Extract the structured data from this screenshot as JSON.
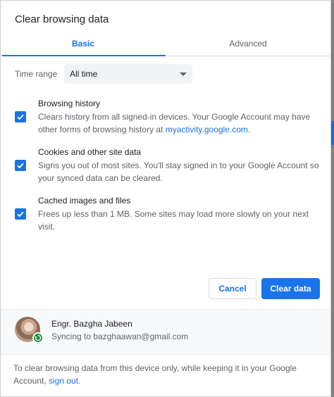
{
  "dialog": {
    "title": "Clear browsing data"
  },
  "tabs": [
    {
      "label": "Basic",
      "active": true
    },
    {
      "label": "Advanced",
      "active": false
    }
  ],
  "time_range": {
    "label": "Time range",
    "value": "All time"
  },
  "options": [
    {
      "title": "Browsing history",
      "desc_pre": "Clears history from all signed-in devices. Your Google Account may have other forms of browsing history at ",
      "desc_link": "myactivity.google.com",
      "desc_post": ".",
      "checked": true
    },
    {
      "title": "Cookies and other site data",
      "desc": "Signs you out of most sites. You'll stay signed in to your Google Account so your synced data can be cleared.",
      "checked": true
    },
    {
      "title": "Cached images and files",
      "desc": "Frees up less than 1 MB. Some sites may load more slowly on your next visit.",
      "checked": true
    }
  ],
  "buttons": {
    "cancel": "Cancel",
    "clear": "Clear data"
  },
  "account": {
    "name": "Engr. Bazgha Jabeen",
    "sync_status": "Syncing to bazghaawan@gmail.com"
  },
  "footer": {
    "text_pre": "To clear browsing data from this device only, while keeping it in your Google Account, ",
    "link": "sign out",
    "text_post": "."
  },
  "colors": {
    "accent": "#1a73e8",
    "sync_badge": "#1e8e3e"
  },
  "icons": [
    "checkbox-checked-icon",
    "dropdown-caret-icon",
    "sync-icon"
  ]
}
